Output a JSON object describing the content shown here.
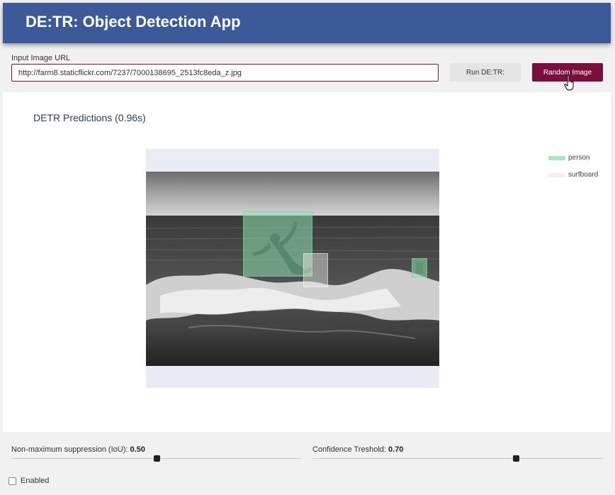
{
  "app": {
    "title": "DE:TR: Object Detection App"
  },
  "input": {
    "label": "Input Image URL",
    "value": "http://farm8.staticflickr.com/7237/7000138695_2513fc8eda_z.jpg"
  },
  "buttons": {
    "run_label": "Run DE:TR:",
    "random_label": "Random Image"
  },
  "predictions": {
    "title": "DETR Predictions (0.96s)",
    "legend": [
      {
        "label": "person",
        "color": "#a8e6c6"
      },
      {
        "label": "surfboard",
        "color": "#f0f0f0"
      }
    ],
    "detections": [
      {
        "label": "person"
      },
      {
        "label": "surfboard"
      },
      {
        "label": "person"
      }
    ]
  },
  "controls": {
    "nms": {
      "label": "Non-maximum suppression (IoU): ",
      "value": "0.50",
      "fraction": 0.5
    },
    "confidence": {
      "label": "Confidence Treshold: ",
      "value": "0.70",
      "fraction": 0.7
    },
    "enabled": {
      "label": "Enabled",
      "checked": false
    }
  },
  "colors": {
    "header": "#3d5a98",
    "accent": "#7b0e3c",
    "person_box": "#8ce1af"
  }
}
